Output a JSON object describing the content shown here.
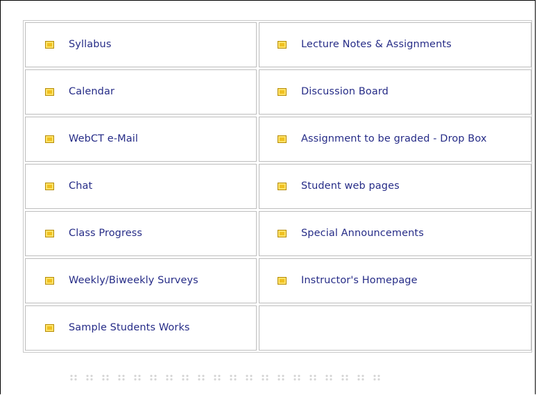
{
  "menu": {
    "left": [
      "Syllabus",
      "Calendar",
      "WebCT e-Mail",
      "Chat",
      "Class Progress",
      "Weekly/Biweekly Surveys",
      "Sample Students Works"
    ],
    "right": [
      "Lecture Notes & Assignments",
      "Discussion Board",
      "Assignment to be graded - Drop Box",
      "Student web pages",
      "Special Announcements",
      "Instructor's Homepage"
    ]
  },
  "icons": {
    "bullet": "yellow-square-bullet-icon",
    "divider": "dotted-divider-icon"
  },
  "colors": {
    "link_text": "#262c87",
    "bullet_fill": "#f0c020",
    "cell_border": "#bdbdbd"
  }
}
